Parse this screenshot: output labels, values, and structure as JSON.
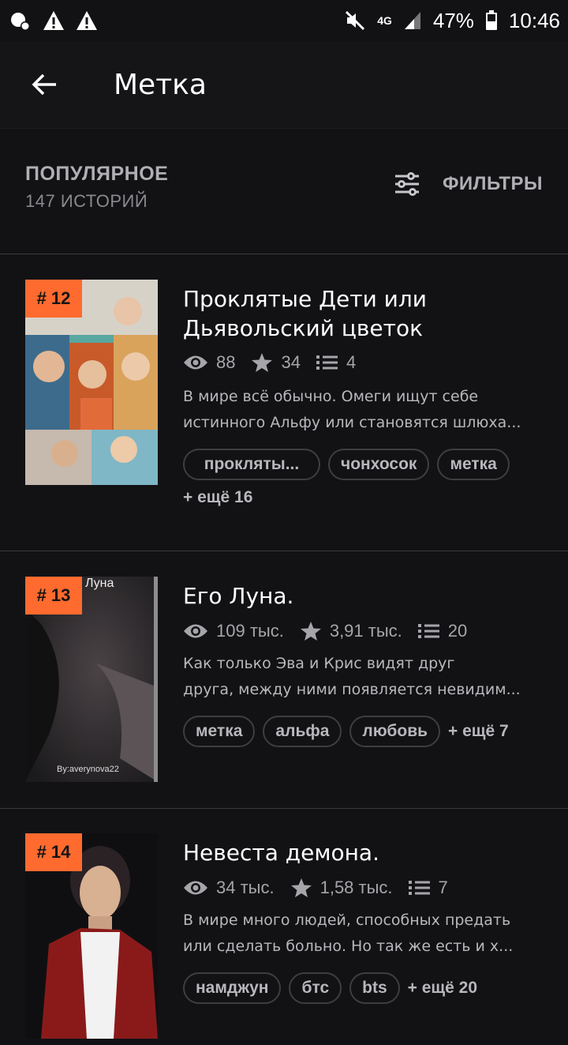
{
  "status_bar": {
    "network": "4G",
    "battery": "47%",
    "time": "10:46"
  },
  "header": {
    "title": "Метка"
  },
  "listing": {
    "sort_label": "ПОПУЛЯРНОЕ",
    "count_label": "147 ИСТОРИЙ",
    "filter_label": "ФИЛЬТРЫ"
  },
  "stories": [
    {
      "rank": "# 12",
      "title_line1": "Проклятые Дети или",
      "title_line2": "Дьявольский цветок",
      "reads": "88",
      "votes": "34",
      "parts": "4",
      "desc_line1": "В мире всё обычно. Омеги ищут себе",
      "desc_line2": "истинного Альфу или становятся шлюха...",
      "tags": [
        "прокляты...",
        "чонхосок",
        "метка"
      ],
      "more": "+ ещё 16"
    },
    {
      "rank": "# 13",
      "cover_text": "Луна",
      "cover_author": "By:averynova22",
      "title_line1": "Его Луна.",
      "reads": "109 тыс.",
      "votes": "3,91 тыс.",
      "parts": "20",
      "desc_line1": "Как только Эва и Крис видят друг",
      "desc_line2": "друга, между ними появляется невидим...",
      "tags": [
        "метка",
        "альфа",
        "любовь"
      ],
      "more": "+ ещё 7"
    },
    {
      "rank": "# 14",
      "title_line1": "Невеста демона.",
      "reads": "34 тыс.",
      "votes": "1,58 тыс.",
      "parts": "7",
      "desc_line1": "В мире много людей, способных предать",
      "desc_line2": "или сделать больно. Но так же есть и х...",
      "tags": [
        "намджун",
        "бтс",
        "bts"
      ],
      "more": "+ ещё 20"
    }
  ],
  "colors": {
    "accent": "#ff6a2e",
    "background": "#121215"
  },
  "icons": [
    "back-arrow-icon",
    "filter-sliders-icon",
    "eye-icon",
    "star-icon",
    "list-icon"
  ]
}
